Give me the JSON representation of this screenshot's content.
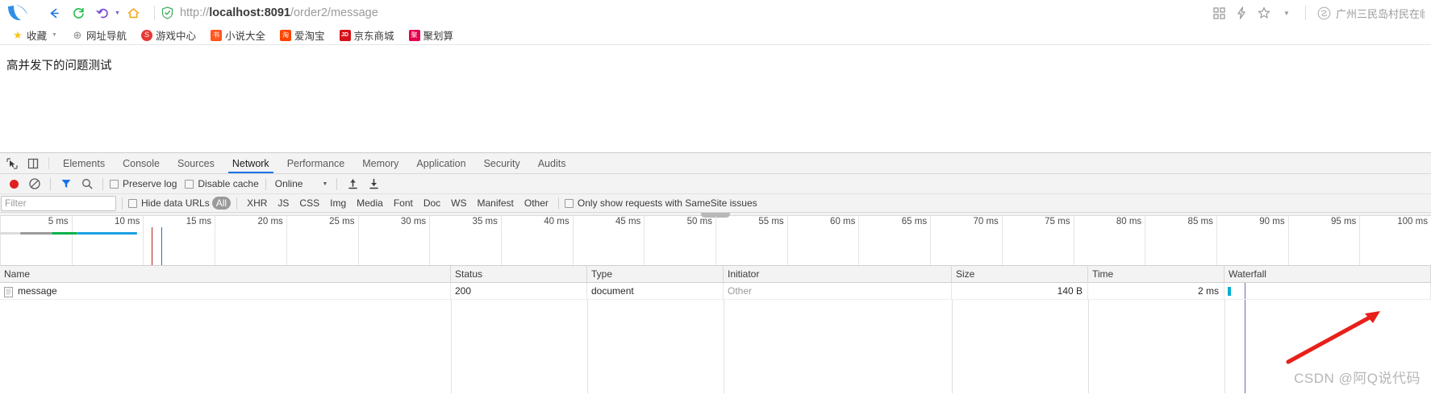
{
  "browser": {
    "nav": {
      "back_icon": "arrow-left-icon",
      "reload_icon": "reload-icon",
      "history_icon": "undo-icon",
      "home_icon": "home-icon"
    },
    "security_icon": "shield-secure-icon",
    "url": {
      "scheme": "http://",
      "host": "localhost:8091",
      "path": "/order2/message",
      "full": "http://localhost:8091/order2/message"
    },
    "right_icons": [
      "apps-grid-icon",
      "lightning-icon",
      "star-icon",
      "chevron-down-icon"
    ],
    "account": {
      "avatar_icon": "account-circle-icon",
      "label": "广州三民岛村民在临时..."
    }
  },
  "bookmarks": [
    {
      "label": "收藏",
      "icon": "star-icon",
      "color": "#f5c518",
      "has_caret": true,
      "glyph": "★"
    },
    {
      "label": "网址导航",
      "icon": "globe-icon",
      "color": "#8c8c8c",
      "has_caret": false,
      "glyph": "⊕"
    },
    {
      "label": "游戏中心",
      "icon": "game-icon",
      "color": "#e53935",
      "has_caret": false,
      "glyph": "S"
    },
    {
      "label": "小说大全",
      "icon": "book-icon",
      "color": "#ff5722",
      "has_caret": false,
      "glyph": "书"
    },
    {
      "label": "爱淘宝",
      "icon": "taobao-icon",
      "color": "#ff4400",
      "has_caret": false,
      "glyph": "淘"
    },
    {
      "label": "京东商城",
      "icon": "jd-icon",
      "color": "#d71118",
      "has_caret": false,
      "glyph": "JD"
    },
    {
      "label": "聚划算",
      "icon": "juhuasuan-icon",
      "color": "#e8004c",
      "has_caret": false,
      "glyph": "聚"
    }
  ],
  "page": {
    "body_text": "高并发下的问题测试"
  },
  "devtools": {
    "left_icons": [
      "inspect-element-icon",
      "device-toolbar-icon"
    ],
    "tabs": [
      {
        "label": "Elements",
        "active": false
      },
      {
        "label": "Console",
        "active": false
      },
      {
        "label": "Sources",
        "active": false
      },
      {
        "label": "Network",
        "active": true
      },
      {
        "label": "Performance",
        "active": false
      },
      {
        "label": "Memory",
        "active": false
      },
      {
        "label": "Application",
        "active": false
      },
      {
        "label": "Security",
        "active": false
      },
      {
        "label": "Audits",
        "active": false
      }
    ],
    "network_toolbar": {
      "record_label": "record-button",
      "clear_label": "clear-button",
      "filter_icon": "funnel-icon",
      "search_icon": "search-icon",
      "preserve_log": {
        "label": "Preserve log",
        "checked": false
      },
      "disable_cache": {
        "label": "Disable cache",
        "checked": false
      },
      "throttling": {
        "value": "Online",
        "caret": "▼"
      },
      "import_icon": "upload-icon",
      "export_icon": "download-icon"
    },
    "filter_bar": {
      "filter_placeholder": "Filter",
      "filter_value": "",
      "hide_data_urls": {
        "label": "Hide data URLs",
        "checked": false
      },
      "types": [
        "All",
        "XHR",
        "JS",
        "CSS",
        "Img",
        "Media",
        "Font",
        "Doc",
        "WS",
        "Manifest",
        "Other"
      ],
      "active_type": "All",
      "samesite": {
        "label": "Only show requests with SameSite issues",
        "checked": false
      }
    },
    "overview": {
      "ticks": [
        "5 ms",
        "10 ms",
        "15 ms",
        "20 ms",
        "25 ms",
        "30 ms",
        "35 ms",
        "40 ms",
        "45 ms",
        "50 ms",
        "55 ms",
        "60 ms",
        "65 ms",
        "70 ms",
        "75 ms",
        "80 ms",
        "85 ms",
        "90 ms",
        "95 ms",
        "100 ms"
      ],
      "event_lines": [
        {
          "name": "dom-content-loaded-line",
          "color": "#b5251f",
          "left_pct": 10.6
        },
        {
          "name": "load-event-line",
          "color": "#1f6fd0",
          "left_pct": 11.3
        }
      ],
      "request_bar_segments": [
        {
          "name": "queueing",
          "color": "#dcdcdc",
          "width_pct": 1.4
        },
        {
          "name": "stalled",
          "color": "#9a9a9a",
          "width_pct": 2.2
        },
        {
          "name": "waiting-ttfb",
          "color": "#0cb14b",
          "width_pct": 1.8
        },
        {
          "name": "content-download",
          "color": "#1ba1e2",
          "width_pct": 4.2
        }
      ]
    },
    "requests": {
      "columns": [
        "Name",
        "Status",
        "Type",
        "Initiator",
        "Size",
        "Time",
        "Waterfall"
      ],
      "rows": [
        {
          "name": "message",
          "status": "200",
          "type": "document",
          "initiator": "Other",
          "size": "140 B",
          "time": "2 ms",
          "icon": "document-icon"
        }
      ]
    }
  },
  "watermark": {
    "text": "CSDN @阿Q说代码",
    "arrow_color": "#e8201a"
  }
}
